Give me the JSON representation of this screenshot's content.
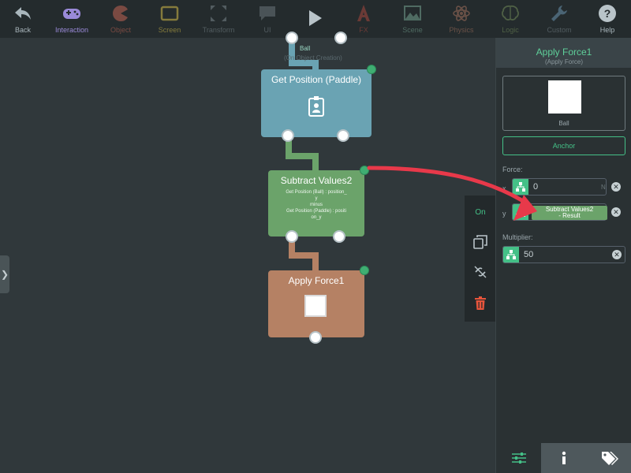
{
  "toolbar": {
    "items": [
      {
        "label": "Back",
        "icon": "back-arrow-icon"
      },
      {
        "label": "Interaction",
        "icon": "gamepad-icon"
      },
      {
        "label": "Object",
        "icon": "pacman-icon"
      },
      {
        "label": "Screen",
        "icon": "screen-icon"
      },
      {
        "label": "Transform",
        "icon": "transform-icon"
      },
      {
        "label": "UI",
        "icon": "speech-bubble-icon"
      },
      {
        "label": "",
        "icon": "play-icon"
      },
      {
        "label": "FX",
        "icon": "fx-icon"
      },
      {
        "label": "Scene",
        "icon": "picture-icon"
      },
      {
        "label": "Physics",
        "icon": "atom-icon"
      },
      {
        "label": "Logic",
        "icon": "brain-icon"
      },
      {
        "label": "Custom",
        "icon": "wrench-icon"
      },
      {
        "label": "Help",
        "icon": "help-icon"
      }
    ]
  },
  "canvas": {
    "ball_label": "Ball",
    "ball_sub": "(On Object Creation)",
    "nodes": {
      "get_position": {
        "title": "Get Position (Paddle)",
        "icon": "badge-icon"
      },
      "subtract": {
        "title": "Subtract Values2",
        "line1": "Get Position (Ball) : position_",
        "line2": "y",
        "line3": "minus",
        "line4": "Get Position (Paddle) : positi",
        "line5": "on_y"
      },
      "apply_force": {
        "title": "Apply Force1",
        "icon": "square-icon"
      }
    }
  },
  "context_menu": {
    "on_label": "On",
    "items": [
      "copy-icon",
      "unlink-icon",
      "trash-icon"
    ]
  },
  "panel": {
    "title": "Apply Force1",
    "subtitle": "(Apply Force)",
    "preview_label": "Ball",
    "anchor_label": "Anchor",
    "force_label": "Force:",
    "x_axis": "x",
    "x_value": "0",
    "x_unit": "N",
    "y_axis": "y",
    "y_chip_line1": "Subtract Values2",
    "y_chip_line2": "- Result",
    "multiplier_label": "Multiplier:",
    "multiplier_value": "50"
  },
  "colors": {
    "accent": "#44c087",
    "arrow": "#e8394a",
    "node_blue": "#6aa3b3",
    "node_green": "#6ba36a",
    "node_brown": "#b58164"
  }
}
